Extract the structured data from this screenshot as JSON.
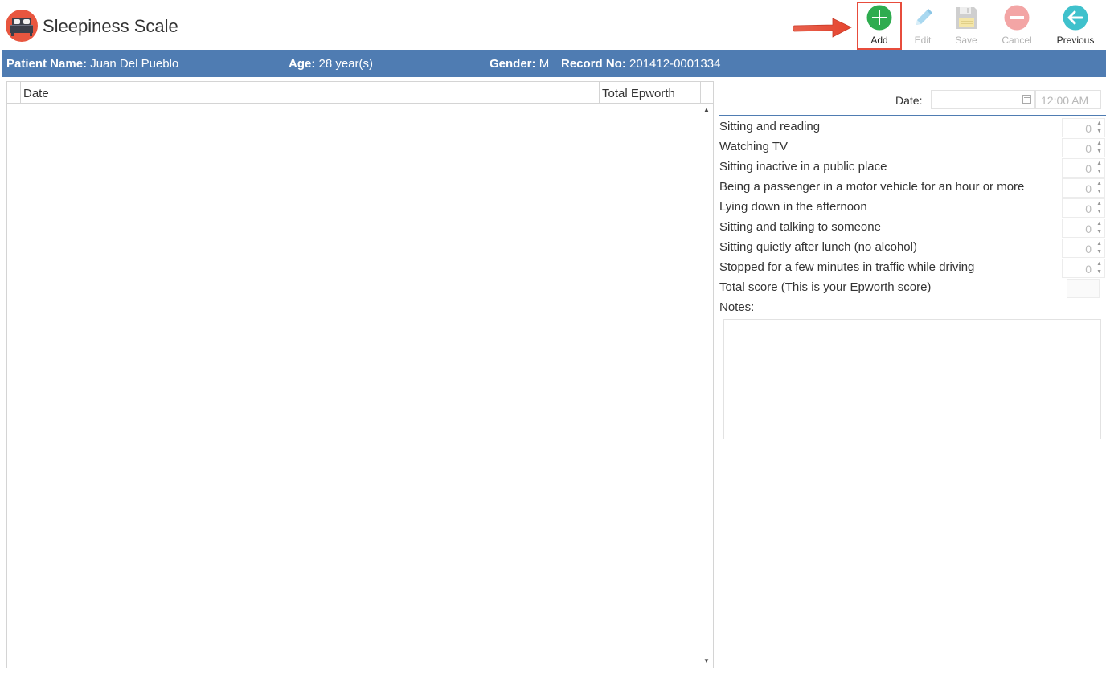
{
  "app": {
    "title": "Sleepiness Scale",
    "icon": "bed-icon"
  },
  "toolbar": {
    "add_label": "Add",
    "edit_label": "Edit",
    "save_label": "Save",
    "cancel_label": "Cancel",
    "previous_label": "Previous",
    "colors": {
      "add": "#2eac4f",
      "edit": "#9fd3ee",
      "save": "#c8c8c8",
      "cancel": "#f3a5a5",
      "previous": "#3fc1cc",
      "highlight": "#e74c3c"
    }
  },
  "patient": {
    "name_label": "Patient Name:",
    "name_value": "Juan Del Pueblo",
    "age_label": "Age:",
    "age_value": "28 year(s)",
    "gender_label": "Gender:",
    "gender_value": "M",
    "record_label": "Record No:",
    "record_value": "201412-0001334",
    "bar_color": "#4f7cb2"
  },
  "grid": {
    "columns": [
      "Date",
      "Total Epworth"
    ],
    "rows": []
  },
  "form": {
    "date_label": "Date:",
    "date_value": "",
    "time_value": "12:00 AM",
    "questions": [
      {
        "label": "Sitting and reading",
        "value": "0"
      },
      {
        "label": "Watching TV",
        "value": "0"
      },
      {
        "label": "Sitting inactive in a public place",
        "value": "0"
      },
      {
        "label": "Being a passenger in a motor vehicle for an hour or more",
        "value": "0"
      },
      {
        "label": "Lying down in the afternoon",
        "value": "0"
      },
      {
        "label": "Sitting and talking to someone",
        "value": "0"
      },
      {
        "label": "Sitting quietly after lunch (no alcohol)",
        "value": "0"
      },
      {
        "label": "Stopped for a few minutes in traffic while driving",
        "value": "0"
      }
    ],
    "total_label": "Total score (This is your Epworth score)",
    "total_value": "",
    "notes_label": "Notes:",
    "notes_value": ""
  }
}
